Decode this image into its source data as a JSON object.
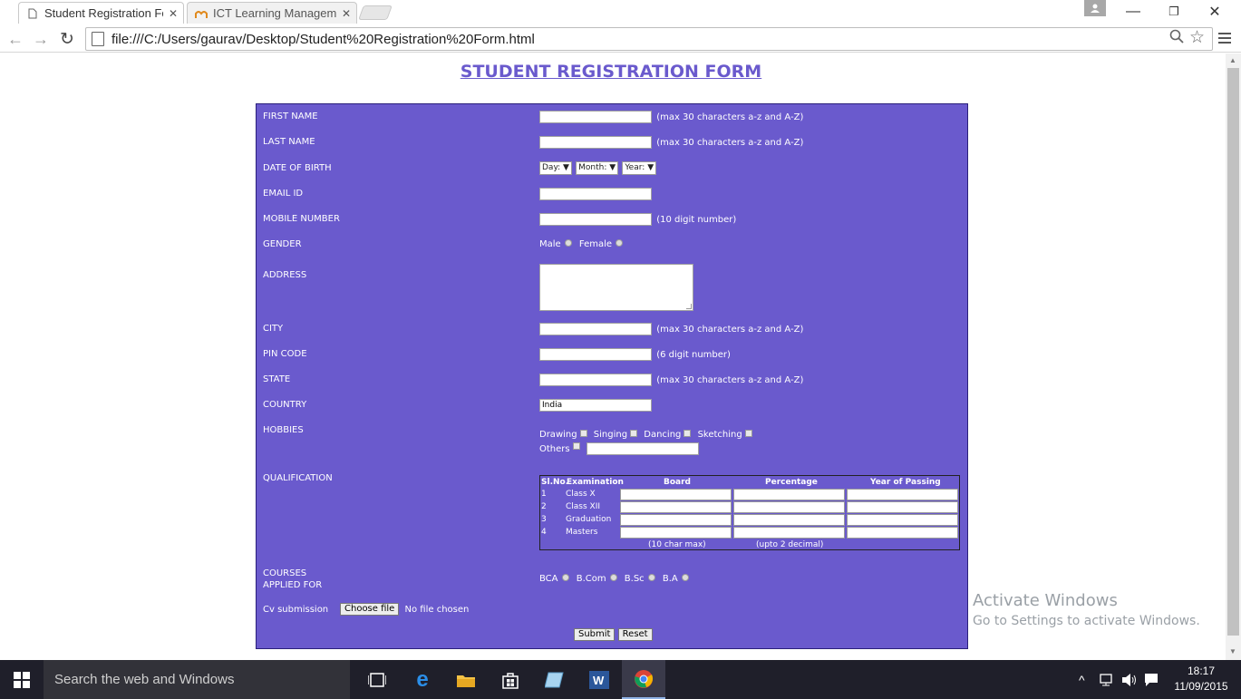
{
  "browser": {
    "tabs": [
      {
        "title": "Student Registration Form",
        "active": true
      },
      {
        "title": "ICT Learning Managemen",
        "active": false
      }
    ],
    "url": "file:///C:/Users/gaurav/Desktop/Student%20Registration%20Form.html"
  },
  "page": {
    "heading": "STUDENT REGISTRATION FORM",
    "form": {
      "first_name": {
        "label": "FIRST NAME",
        "hint": "(max 30 characters a-z and A-Z)",
        "value": ""
      },
      "last_name": {
        "label": "LAST NAME",
        "hint": "(max 30 characters a-z and A-Z)",
        "value": ""
      },
      "dob": {
        "label": "DATE OF BIRTH",
        "day": "Day:",
        "month": "Month:",
        "year": "Year:"
      },
      "email": {
        "label": "EMAIL ID",
        "value": ""
      },
      "mobile": {
        "label": "MOBILE NUMBER",
        "hint": "(10 digit number)",
        "value": ""
      },
      "gender": {
        "label": "GENDER",
        "options": [
          "Male",
          "Female"
        ]
      },
      "address": {
        "label": "ADDRESS",
        "value": ""
      },
      "city": {
        "label": "CITY",
        "hint": "(max 30 characters a-z and A-Z)",
        "value": ""
      },
      "pin": {
        "label": "PIN CODE",
        "hint": "(6 digit number)",
        "value": ""
      },
      "state": {
        "label": "STATE",
        "hint": "(max 30 characters a-z and A-Z)",
        "value": ""
      },
      "country": {
        "label": "COUNTRY",
        "value": "India"
      },
      "hobbies": {
        "label": "HOBBIES",
        "options": [
          "Drawing",
          "Singing",
          "Dancing",
          "Sketching"
        ],
        "others": "Others"
      },
      "qualification": {
        "label": "QUALIFICATION",
        "headers": [
          "Sl.No.",
          "Examination",
          "Board",
          "Percentage",
          "Year of Passing"
        ],
        "rows": [
          {
            "no": "1",
            "exam": "Class X"
          },
          {
            "no": "2",
            "exam": "Class XII"
          },
          {
            "no": "3",
            "exam": "Graduation"
          },
          {
            "no": "4",
            "exam": "Masters"
          }
        ],
        "board_hint": "(10 char max)",
        "percentage_hint": "(upto 2 decimal)"
      },
      "courses": {
        "label_line1": "COURSES",
        "label_line2": "APPLIED FOR",
        "options": [
          "BCA",
          "B.Com",
          "B.Sc",
          "B.A"
        ]
      },
      "cv": {
        "label": "Cv submission",
        "button": "Choose file",
        "status": "No file chosen"
      },
      "submit": "Submit",
      "reset": "Reset"
    }
  },
  "watermark": {
    "line1": "Activate Windows",
    "line2": "Go to Settings to activate Windows."
  },
  "taskbar": {
    "search_placeholder": "Search the web and Windows",
    "time": "18:17",
    "date": "11/09/2015"
  },
  "colors": {
    "form_bg": "#6a5acd",
    "heading": "#6a5acd",
    "taskbar": "#1f1f2a"
  }
}
